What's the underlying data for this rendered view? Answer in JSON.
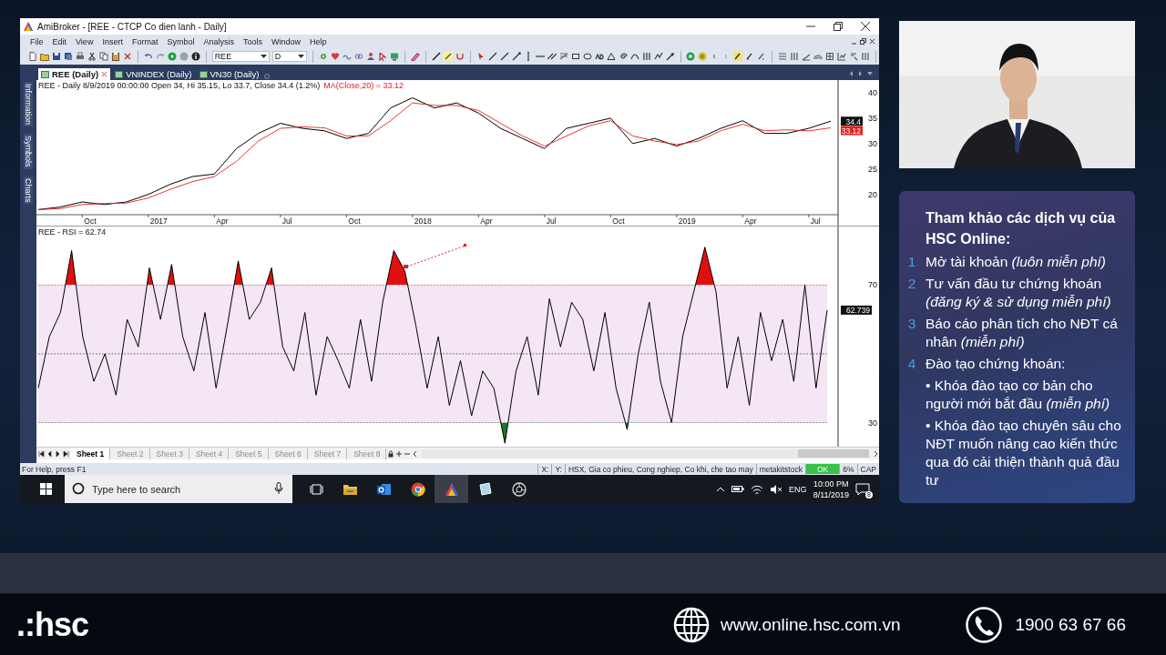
{
  "app_window": {
    "title": "AmiBroker - [REE - CTCP Co dien lanh - Daily]",
    "menu": [
      "File",
      "Edit",
      "View",
      "Insert",
      "Format",
      "Symbol",
      "Analysis",
      "Tools",
      "Window",
      "Help"
    ],
    "toolbar": {
      "symbol": "REE",
      "interval": "D"
    },
    "doc_tabs": [
      {
        "label": "REE (Daily)",
        "selected": true,
        "closable": true
      },
      {
        "label": "VNINDEX (Daily)",
        "selected": false,
        "closable": false
      },
      {
        "label": "VN30 (Daily)",
        "selected": false,
        "closable": false
      }
    ],
    "side_tabs": [
      "Information",
      "Symbols",
      "Charts"
    ],
    "price_pane": {
      "header": "REE - Daily 8/9/2019 00:00:00 Open 34, Hi 35.15, Lo 33.7, Close 34.4 (1.2%)",
      "header_ma": "MA(Close,20) = 33.12",
      "last_badge": "34.4",
      "ma_badge": "33.12",
      "chart_data": {
        "type": "line",
        "categories": [
          null,
          null,
          "Oct",
          null,
          null,
          "2017",
          null,
          null,
          "Apr",
          null,
          null,
          "Jul",
          null,
          null,
          "Oct",
          null,
          null,
          "2018",
          null,
          null,
          "Apr",
          null,
          null,
          "Jul",
          null,
          null,
          "Oct",
          null,
          null,
          "2019",
          null,
          null,
          "Apr",
          null,
          null,
          "Jul",
          null
        ],
        "ylim": [
          16,
          42.5
        ],
        "yticks": [
          20,
          25,
          30,
          35,
          40
        ],
        "series": [
          {
            "color": "#000000",
            "values": [
              17,
              17.5,
              18.5,
              18,
              18.5,
              20,
              22,
              23.5,
              24,
              29,
              32,
              34,
              33,
              32.5,
              31,
              32,
              37,
              39,
              37,
              38,
              36,
              33,
              31,
              29,
              33,
              34,
              35,
              30,
              31,
              29.5,
              31,
              33,
              34.5,
              32,
              32,
              33,
              34.4
            ]
          },
          {
            "color": "#e02020",
            "values": [
              17,
              17.2,
              18,
              18.2,
              18.3,
              19.3,
              21,
              22.5,
              23.5,
              26.5,
              30.5,
              33,
              33.3,
              33.1,
              31.5,
              31.5,
              34.5,
              38,
              37.5,
              37.5,
              36.5,
              34,
              31.5,
              29.5,
              31.5,
              33.5,
              34.5,
              31.5,
              30.5,
              29.8,
              30.5,
              32.5,
              33.8,
              32.5,
              32.7,
              32.5,
              33.1
            ]
          }
        ]
      }
    },
    "rsi_pane": {
      "header": "REE - RSI = 62.74",
      "badge": "62.739",
      "chart_data": {
        "type": "line",
        "ylim": [
          23,
          87
        ],
        "yticks": [
          30,
          70
        ],
        "series": [
          {
            "color": "#000000",
            "values": [
              40,
              55,
              62,
              80,
              55,
              42,
              50,
              38,
              60,
              52,
              75,
              60,
              76,
              55,
              45,
              62,
              40,
              58,
              77,
              60,
              65,
              75,
              52,
              45,
              62,
              38,
              55,
              48,
              40,
              60,
              42,
              65,
              80,
              74,
              58,
              40,
              55,
              35,
              48,
              32,
              45,
              40,
              24,
              45,
              55,
              38,
              66,
              52,
              65,
              60,
              45,
              62,
              40,
              28,
              50,
              65,
              42,
              30,
              55,
              68,
              81,
              68,
              40,
              55,
              35,
              62,
              48,
              60,
              42,
              70,
              40,
              62.7
            ]
          }
        ]
      }
    },
    "sheets": [
      {
        "label": "Sheet 1",
        "selected": true
      },
      {
        "label": "Sheet 2",
        "selected": false
      },
      {
        "label": "Sheet 3",
        "selected": false
      },
      {
        "label": "Sheet 4",
        "selected": false
      },
      {
        "label": "Sheet 5",
        "selected": false
      },
      {
        "label": "Sheet 6",
        "selected": false
      },
      {
        "label": "Sheet 7",
        "selected": false
      },
      {
        "label": "Sheet 8",
        "selected": false
      }
    ],
    "status_bar": {
      "help": "For Help, press F1",
      "x_label": "X:",
      "y_label": "Y:",
      "info": "HSX, Gia co phieu, Cong nghiep, Co khi, che tao may",
      "database": "metakitstock",
      "state": "OK",
      "percent": "6%",
      "caps": "CAP"
    }
  },
  "taskbar": {
    "search": {
      "placeholder": "Type here to search"
    },
    "language": "ENG",
    "time": "10:00 PM",
    "date": "8/11/2019",
    "notifications": "8"
  },
  "services_panel": {
    "title": "Tham khảo các dịch vụ của HSC Online:",
    "items": [
      {
        "number": "1",
        "text": "Mở tài khoản *(luôn miễn phí)*"
      },
      {
        "number": "2",
        "text": "Tư vấn đầu tư chứng khoán *(đăng ký & sử dụng miễn phí)*"
      },
      {
        "number": "3",
        "text": "Báo cáo phân tích cho NĐT cá nhân *(miễn phí)*"
      },
      {
        "number": "4",
        "text": "Đào tạo chứng khoán:",
        "children": [
          {
            "text": "• Khóa đào tạo cơ bản cho người mới bắt đầu *(miễn phí)*"
          },
          {
            "text": "• Khóa đào tạo chuyên sâu cho NĐT muốn nâng cao kiến thức qua đó cải thiện thành quả đầu tư"
          }
        ]
      }
    ]
  },
  "footer": {
    "logo": ".:hsc",
    "website": "www.online.hsc.com.vn",
    "phone": "1900 63 67 66"
  }
}
